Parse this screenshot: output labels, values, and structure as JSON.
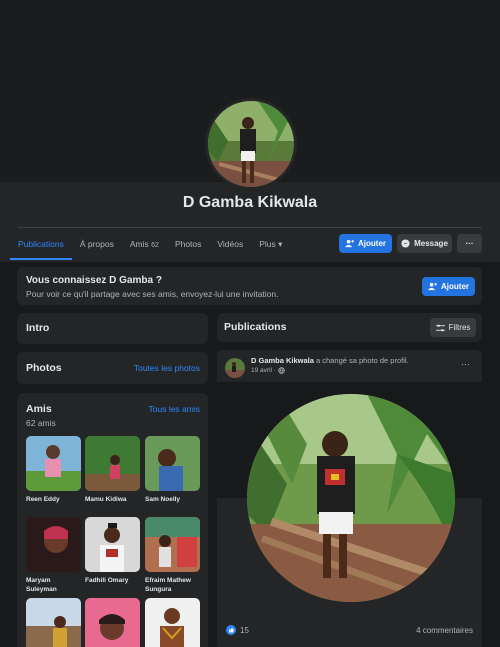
{
  "profile": {
    "name": "D Gamba Kikwala"
  },
  "tabs": [
    {
      "label": "Publications"
    },
    {
      "label": "À propos"
    },
    {
      "label": "Amis",
      "count": "62"
    },
    {
      "label": "Photos"
    },
    {
      "label": "Vidéos"
    },
    {
      "label": "Plus"
    }
  ],
  "actions": {
    "add_label": "Ajouter",
    "message_label": "Message",
    "more_label": "···"
  },
  "suggestion": {
    "title": "Vous connaissez D Gamba ?",
    "text": "Pour voir ce qu'il partage avec ses amis, envoyez-lui une invitation.",
    "button": "Ajouter"
  },
  "intro": {
    "title": "Intro"
  },
  "photos": {
    "title": "Photos",
    "link": "Toutes les photos"
  },
  "friends": {
    "title": "Amis",
    "link": "Tous les amis",
    "count": "62 amis",
    "items": [
      {
        "name": "Reen Eddy"
      },
      {
        "name": "Mamu Kidiwa"
      },
      {
        "name": "Sam Noelly"
      },
      {
        "name": "Maryam Suleyman"
      },
      {
        "name": "Fadhili Omary"
      },
      {
        "name": "Efraim Mathew Sungura"
      },
      {
        "name": ""
      },
      {
        "name": ""
      },
      {
        "name": ""
      }
    ]
  },
  "publications": {
    "title": "Publications",
    "filter": "Filtres"
  },
  "post": {
    "author": "D Gamba Kikwala",
    "action": "a changé sa photo de profil.",
    "date": "19 avril ·",
    "likes": "15",
    "comments": "4 commentaires",
    "more": "···"
  },
  "colors": {
    "accent": "#2d88ff",
    "button_blue": "#2374e1",
    "card": "#242526",
    "background": "#18191a"
  }
}
